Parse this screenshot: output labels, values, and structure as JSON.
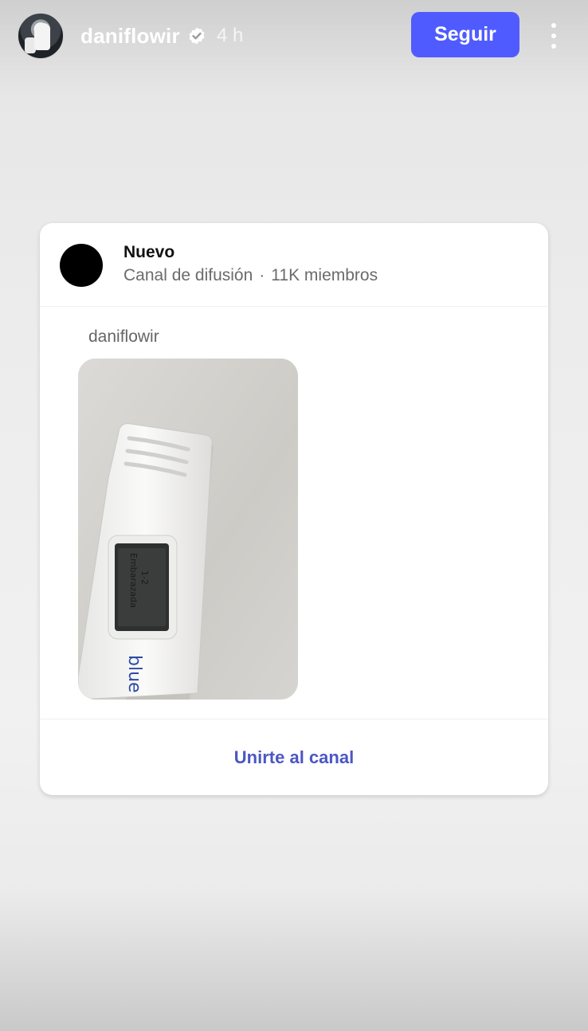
{
  "header": {
    "username": "daniflowir",
    "verified": true,
    "time": "4 h",
    "follow_label": "Seguir",
    "more_icon": "more-vertical-icon",
    "accent_color": "#4f5bff"
  },
  "channel_card": {
    "title": "Nuevo",
    "subtitle_type": "Canal de difusión",
    "separator": "·",
    "members": "11K miembros",
    "sender": "daniflowir",
    "photo_subject": "pregnancy test",
    "join_label": "Unirte al canal",
    "link_color": "#4b56c4"
  }
}
